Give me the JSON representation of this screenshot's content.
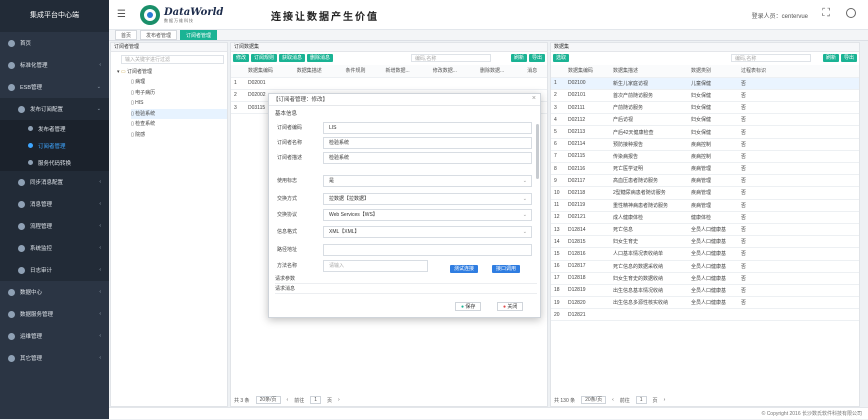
{
  "app_title": "集成平台中心端",
  "brand": {
    "name": "DataWorld",
    "sub": "数据万维科技",
    "slogan": "连接让数据产生价值"
  },
  "login": {
    "label": "登录人员：",
    "user": "centervue"
  },
  "menu": {
    "home": "首页",
    "std": "标准化管理",
    "esb": "ESB管理",
    "pub": "发布订阅配置",
    "pub_mgr": "发布者管理",
    "sub_mgr": "订阅者管理",
    "svc": "服务代码转换",
    "sync": "同步消息配置",
    "msg": "消息管理",
    "flow": "流程管理",
    "mon": "系统监控",
    "log": "日志审计",
    "data": "数据中心",
    "dsvc": "数据服务管理",
    "ops": "运维管理",
    "other": "其它管理"
  },
  "tabs": [
    "首页",
    "发布者管理",
    "订阅者管理"
  ],
  "tree": {
    "title": "订阅者管理",
    "search_ph": "输入关键字进行过滤",
    "root": "订阅者管理",
    "items": [
      "病理",
      "电子病历",
      "HIS",
      "检验系统",
      "检查系统",
      "院感"
    ]
  },
  "mid": {
    "title": "订阅数据集",
    "btn_edit": "修改",
    "btn_rule": "订阅规则",
    "btn_get": "获取消息",
    "btn_del": "删除消息",
    "search_ph": "编码,名称",
    "refresh": "刷新",
    "export": "导出",
    "cols": [
      "数据集编码",
      "数据集描述",
      "条件规则",
      "新增数据...",
      "修改数据...",
      "删除数据...",
      "消息"
    ],
    "rows": [
      [
        "1",
        "D02001"
      ],
      [
        "2",
        "D02002"
      ],
      [
        "3",
        "D03115"
      ]
    ],
    "total": "共 3 条",
    "per": "20条/页",
    "goto": "前往",
    "page": "1",
    "unit": "页"
  },
  "right": {
    "title": "数据集",
    "btn": "选取",
    "search_ph": "编码,名称",
    "refresh": "刷新",
    "export": "导出",
    "cols": [
      "数据集编码",
      "数据集描述",
      "数据类别",
      "过程表标识"
    ],
    "rows": [
      [
        "1",
        "D02100",
        "新生儿家庭访视",
        "儿童保健",
        "否"
      ],
      [
        "2",
        "D02101",
        "首次产前随访服务",
        "妇女保健",
        "否"
      ],
      [
        "3",
        "D02111",
        "产前随访服务",
        "妇女保健",
        "否"
      ],
      [
        "4",
        "D02112",
        "产后访视",
        "妇女保健",
        "否"
      ],
      [
        "5",
        "D02113",
        "产后42天健康检查",
        "妇女保健",
        "否"
      ],
      [
        "6",
        "D02114",
        "预防接种报告",
        "疾病控制",
        "否"
      ],
      [
        "7",
        "D02115",
        "传染病报告",
        "疾病控制",
        "否"
      ],
      [
        "8",
        "D02116",
        "死亡医学证明",
        "疾病管理",
        "否"
      ],
      [
        "9",
        "D02117",
        "高血压患者随访服务",
        "疾病管理",
        "否"
      ],
      [
        "10",
        "D02118",
        "2型糖尿病患者随访服务",
        "疾病管理",
        "否"
      ],
      [
        "11",
        "D02119",
        "重性精神病患者随访服务",
        "疾病管理",
        "否"
      ],
      [
        "12",
        "D02121",
        "成人健康体检",
        "健康体检",
        "否"
      ],
      [
        "13",
        "D12814",
        "死亡信息",
        "全员人口健康基",
        "否"
      ],
      [
        "14",
        "D12815",
        "妇女生育史",
        "全员人口健康基",
        "否"
      ],
      [
        "15",
        "D12816",
        "人口基本情况表收纳单",
        "全员人口健康基",
        "否"
      ],
      [
        "16",
        "D12817",
        "死亡信息的数据采收纳",
        "全员人口健康基",
        "否"
      ],
      [
        "17",
        "D12818",
        "妇女生育史的数据收纳",
        "全员人口健康基",
        "否"
      ],
      [
        "18",
        "D12819",
        "出生信息基本情况收纳",
        "全员人口健康基",
        "否"
      ],
      [
        "19",
        "D12820",
        "出生信息多源性核实收纳",
        "全员人口健康基",
        "否"
      ],
      [
        "20",
        "D12821",
        "",
        "",
        ""
      ]
    ],
    "total": "共 130 条",
    "per": "20条/页",
    "goto": "前往",
    "page": "1",
    "unit": "页"
  },
  "modal": {
    "title": "【订阅者管理：修改】",
    "section": "基本信息",
    "fields": [
      [
        "订阅者编码",
        "LIS"
      ],
      [
        "订阅者名称",
        "检验系统"
      ],
      [
        "订阅者描述",
        "检验系统"
      ],
      [
        "使用标志",
        "是"
      ],
      [
        "交换方式",
        "拉数据【拉数据】"
      ],
      [
        "交换协议",
        "Web Services【WS】"
      ],
      [
        "信息格式",
        "XML【XML】"
      ],
      [
        "路径地址",
        ""
      ],
      [
        "方法名称",
        "请输入"
      ]
    ],
    "btn_test": "测试连接",
    "btn_call": "接口调用",
    "req": "请求参数",
    "req_msg": "请求消息",
    "save": "保存",
    "close": "关闭"
  },
  "copyright": "© Copyright 2016 长沙数氏软件科技有限公司"
}
